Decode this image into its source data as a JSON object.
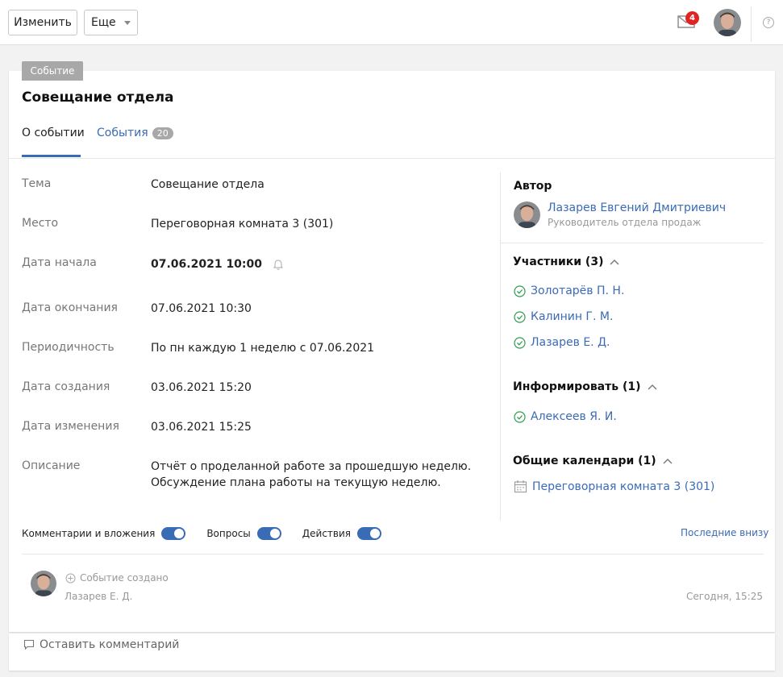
{
  "toolbar": {
    "edit_label": "Изменить",
    "more_label": "Еще",
    "mail_badge": "4",
    "help_glyph": "?"
  },
  "entity": {
    "type_tag": "Событие",
    "title": "Совещание отдела"
  },
  "tabs": [
    {
      "label": "О событии",
      "active": true
    },
    {
      "label": "События",
      "count": "20"
    }
  ],
  "fields": [
    {
      "label": "Тема",
      "value": "Совещание отдела"
    },
    {
      "label": "Место",
      "value": "Переговорная комната 3 (301)"
    },
    {
      "label": "Дата начала",
      "value": "07.06.2021 10:00"
    },
    {
      "label": "Дата окончания",
      "value": "07.06.2021 10:30"
    },
    {
      "label": "Периодичность",
      "value": "По пн каждую 1 неделю с 07.06.2021"
    },
    {
      "label": "Дата создания",
      "value": "03.06.2021 15:20"
    },
    {
      "label": "Дата изменения",
      "value": "03.06.2021 15:25"
    },
    {
      "label": "Описание",
      "value_line1": "Отчёт о проделанной работе за прошедшую неделю.",
      "value_line2": "Обсуждение плана работы на текущую неделю."
    }
  ],
  "sidebar": {
    "author_heading": "Автор",
    "author_name": "Лазарев Евгений Дмитриевич",
    "author_role": "Руководитель отдела продаж",
    "participants_heading": "Участники (3)",
    "participants": [
      "Золотарёв П. Н.",
      "Калинин Г. М.",
      "Лазарев Е. Д."
    ],
    "inform_heading": "Информировать (1)",
    "inform": [
      "Алексеев Я. И."
    ],
    "calendars_heading": "Общие календари (1)",
    "calendars": [
      "Переговорная комната 3 (301)"
    ]
  },
  "feed_controls": {
    "toggles": [
      {
        "label": "Комментарии и вложения",
        "on": true
      },
      {
        "label": "Вопросы",
        "on": true
      },
      {
        "label": "Действия",
        "on": true
      }
    ],
    "sort_label": "Последние внизу"
  },
  "feed": [
    {
      "event": "Событие создано",
      "author": "Лазарев Е. Д.",
      "time": "Сегодня, 15:25"
    }
  ],
  "comment": {
    "placeholder": "Оставить комментарий"
  },
  "colors": {
    "accent": "#3a6bb5",
    "badge": "#e02424",
    "success": "#2e9e4f"
  }
}
